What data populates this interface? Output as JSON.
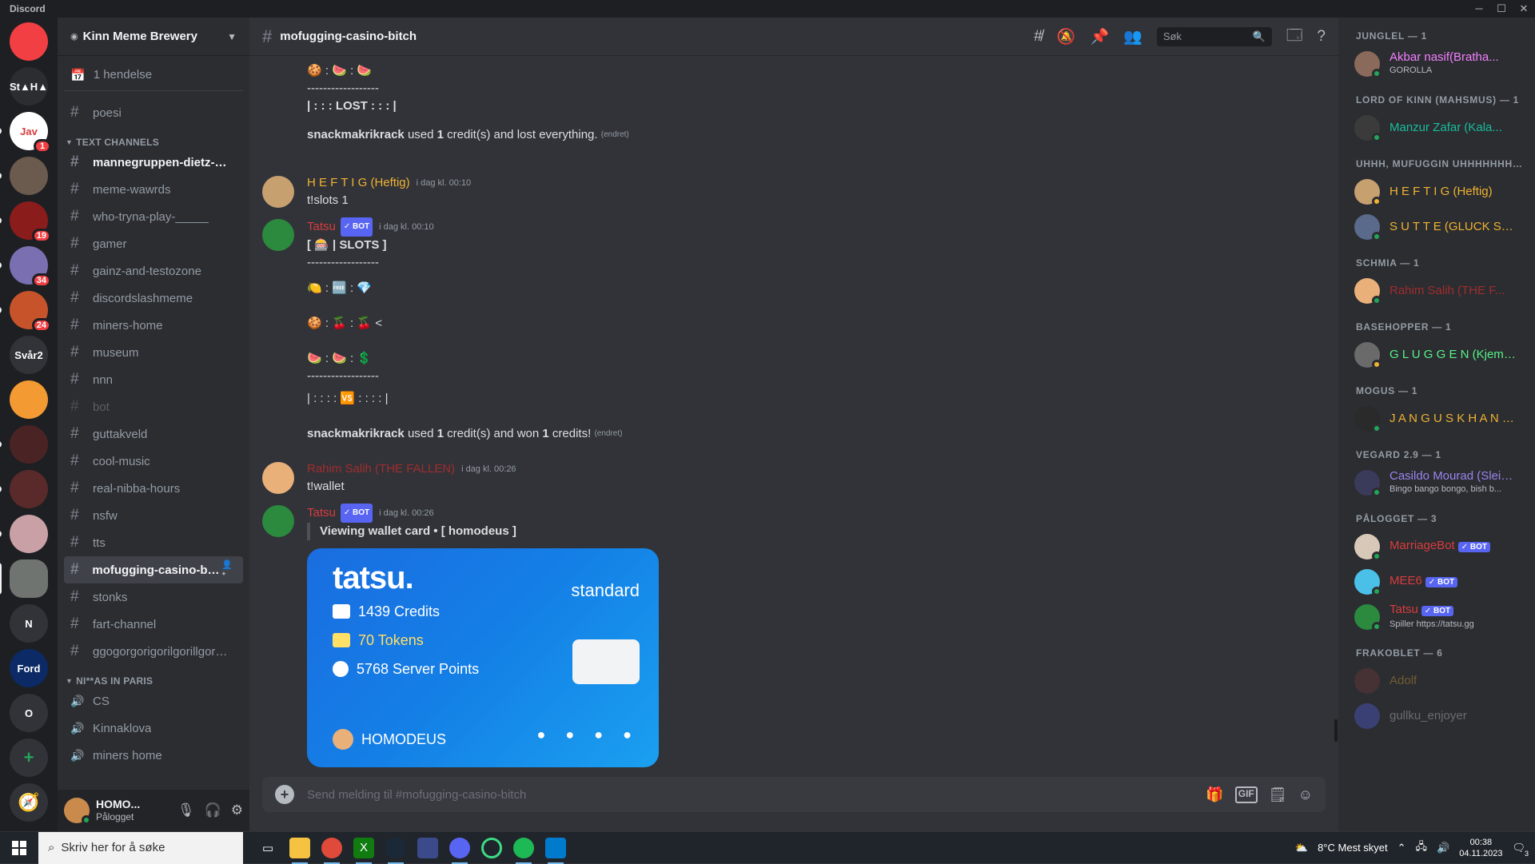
{
  "window": {
    "title": "Discord"
  },
  "servers": [
    {
      "name": "discord-home",
      "label": "",
      "color": "#f23f43",
      "badge": ""
    },
    {
      "name": "server-staha",
      "label": "St▲H▲",
      "color": "#2b2d31",
      "badge": ""
    },
    {
      "name": "server-java",
      "label": "Jav",
      "color": "#ffffff",
      "badge": "1"
    },
    {
      "name": "server-rat",
      "label": "",
      "color": "#6b5a4e",
      "badge": ""
    },
    {
      "name": "server-tekken",
      "label": "",
      "color": "#8b1c1c",
      "badge": "19"
    },
    {
      "name": "server-face",
      "label": "",
      "color": "#7a6fb0",
      "badge": "34"
    },
    {
      "name": "server-fire",
      "label": "",
      "color": "#c6532a",
      "badge": "24"
    },
    {
      "name": "server-svar2",
      "label": "Svår2",
      "color": "#313338",
      "badge": ""
    },
    {
      "name": "server-pizza",
      "label": "",
      "color": "#f39a33",
      "badge": ""
    },
    {
      "name": "server-dark-face",
      "label": "",
      "color": "#4a2424",
      "badge": ""
    },
    {
      "name": "server-red-face",
      "label": "",
      "color": "#5a2a2a",
      "badge": ""
    },
    {
      "name": "server-pink",
      "label": "",
      "color": "#c8a0a5",
      "badge": ""
    },
    {
      "name": "server-kinn",
      "label": "",
      "color": "#6f7470",
      "badge": ""
    },
    {
      "name": "server-n",
      "label": "N",
      "color": "#313338",
      "badge": ""
    },
    {
      "name": "server-ford",
      "label": "Ford",
      "color": "#0b2a66",
      "badge": ""
    },
    {
      "name": "server-o",
      "label": "O",
      "color": "#313338",
      "badge": ""
    }
  ],
  "guild": {
    "name": "Kinn Meme Brewery"
  },
  "channels": {
    "event": "1 hendelse",
    "top": [
      {
        "name": "poesi",
        "state": "normal"
      }
    ],
    "categories": [
      {
        "label": "TEXT CHANNELS",
        "items": [
          {
            "name": "mannegruppen-dietz-nuts",
            "state": "unread"
          },
          {
            "name": "meme-wawrds",
            "state": "normal"
          },
          {
            "name": "who-tryna-play-_____",
            "state": "normal"
          },
          {
            "name": "gamer",
            "state": "normal"
          },
          {
            "name": "gainz-and-testozone",
            "state": "normal"
          },
          {
            "name": "discordslashmeme",
            "state": "normal"
          },
          {
            "name": "miners-home",
            "state": "normal"
          },
          {
            "name": "museum",
            "state": "normal"
          },
          {
            "name": "nnn",
            "state": "normal"
          },
          {
            "name": "bot",
            "state": "muted"
          },
          {
            "name": "guttakveld",
            "state": "normal"
          },
          {
            "name": "cool-music",
            "state": "normal"
          },
          {
            "name": "real-nibba-hours",
            "state": "normal"
          },
          {
            "name": "nsfw",
            "state": "normal"
          },
          {
            "name": "tts",
            "state": "normal"
          },
          {
            "name": "mofugging-casino-bit...",
            "state": "selected"
          },
          {
            "name": "stonks",
            "state": "normal"
          },
          {
            "name": "fart-channel",
            "state": "normal"
          },
          {
            "name": "ggogorgorigorilgorillgorilla",
            "state": "normal"
          }
        ]
      },
      {
        "label": "NI**AS IN PARIS",
        "items": [
          {
            "name": "CS",
            "state": "voice"
          },
          {
            "name": "Kinnaklova",
            "state": "voice"
          },
          {
            "name": "miners home",
            "state": "voice"
          }
        ]
      }
    ]
  },
  "user": {
    "name": "HOMO...",
    "status": "Pålogget"
  },
  "header": {
    "channel": "mofugging-casino-bitch",
    "search_placeholder": "Søk"
  },
  "messages": {
    "m1": {
      "line1": "🍪 : 🍉 : 🍉",
      "line2": "------------------",
      "line3": "| : : :  LOST  : : : |",
      "footer_user": "snackmakrikrack",
      "footer_used": "used",
      "footer_credits": "1",
      "footer_text": "credit(s) and lost everything.",
      "edited": "(endret)"
    },
    "m2": {
      "author": "H E F T I G (Heftig)",
      "author_color": "#f0b232",
      "ts": "i dag kl. 00:10",
      "text": "t!slots 1"
    },
    "m3": {
      "author": "Tatsu",
      "author_color": "#d83c3e",
      "bot": "✓ BOT",
      "ts": "i dag kl. 00:10",
      "title": "[ 🎰 | SLOTS ]",
      "sep": "------------------",
      "r1": "🍋 : 🆓 : 💎",
      "r2": "🍪 : 🍒 : 🍒  <",
      "r3": "🍉 : 🍉 : 💲",
      "sep2": "------------------",
      "result": "| : : : :  🆚  : : : : |",
      "footer_user": "snackmakrikrack",
      "footer_used": "used",
      "footer_credits": "1",
      "footer_mid": "credit(s) and won",
      "footer_won": "1",
      "footer_end": "credits!",
      "edited": "(endret)"
    },
    "m4": {
      "author": "Rahim Salih (THE FALLEN)",
      "author_color": "#a12d2f",
      "ts": "i dag kl. 00:26",
      "text": "t!wallet"
    },
    "m5": {
      "author": "Tatsu",
      "author_color": "#d83c3e",
      "bot": "✓ BOT",
      "ts": "i dag kl. 00:26",
      "title": "Viewing wallet card • [  homodeus ]"
    }
  },
  "wallet": {
    "brand": "tatsu.",
    "tier": "standard",
    "credits": "1439 Credits",
    "tokens": "70 Tokens",
    "points": "5768 Server Points",
    "owner": "HOMODEUS",
    "dots": "● ● ● ●"
  },
  "composer": {
    "placeholder": "Send melding til #mofugging-casino-bitch"
  },
  "members": [
    {
      "group": "JUNGLEL — 1",
      "users": [
        {
          "name": "Akbar nasif(Bratha...",
          "color": "#f47fff",
          "sub": "GOROLLA",
          "status": "online",
          "bot": ""
        }
      ]
    },
    {
      "group": "LORD OF KINN (MAHSMUS) — 1",
      "users": [
        {
          "name": "Manzur Zafar (Kala...",
          "color": "#1abc9c",
          "sub": "",
          "status": "online",
          "bot": ""
        }
      ]
    },
    {
      "group": "UHHH, MUFUGGIN UHHHHHHHHH ...",
      "users": [
        {
          "name": "H E F T I G (Heftig)",
          "color": "#f0b232",
          "sub": "",
          "status": "idle",
          "bot": ""
        },
        {
          "name": "S U T T E (GLUCK SLU...",
          "color": "#f0b232",
          "sub": "",
          "status": "online",
          "bot": ""
        }
      ]
    },
    {
      "group": "SCHMIA — 1",
      "users": [
        {
          "name": "Rahim Salih (THE F...",
          "color": "#a12d2f",
          "sub": "",
          "status": "online",
          "bot": ""
        }
      ]
    },
    {
      "group": "BASEHOPPER — 1",
      "users": [
        {
          "name": "G L U G G E N (Kjemp...",
          "color": "#57f287",
          "sub": "",
          "status": "idle",
          "bot": ""
        }
      ]
    },
    {
      "group": "MOGUS — 1",
      "users": [
        {
          "name": "J A N G U S K H A N B(...",
          "color": "#f0b232",
          "sub": "",
          "status": "online",
          "bot": ""
        }
      ]
    },
    {
      "group": "VEGARD 2.9 — 1",
      "users": [
        {
          "name": "Casildo Mourad (Sleip...",
          "color": "#9b84ee",
          "sub": "Bingo bango bongo, bish b...",
          "status": "online",
          "bot": ""
        }
      ]
    },
    {
      "group": "PÅLOGGET — 3",
      "users": [
        {
          "name": "MarriageBot",
          "color": "#d83c3e",
          "sub": "",
          "status": "online",
          "bot": "✓ BOT"
        },
        {
          "name": "MEE6",
          "color": "#d83c3e",
          "sub": "",
          "status": "online",
          "bot": "✓ BOT"
        },
        {
          "name": "Tatsu",
          "color": "#d83c3e",
          "sub": "Spiller https://tatsu.gg",
          "status": "online",
          "bot": "✓ BOT"
        }
      ]
    },
    {
      "group": "FRAKOBLET — 6",
      "users": [
        {
          "name": "Adolf",
          "color": "#f0b232",
          "sub": "",
          "status": "offline",
          "bot": ""
        },
        {
          "name": "gullku_enjoyer",
          "color": "#dbdee1",
          "sub": "",
          "status": "offline",
          "bot": ""
        }
      ]
    }
  ],
  "taskbar": {
    "search": "Skriv her for å søke",
    "weather": "8°C  Mest skyet",
    "time": "00:38",
    "date": "04.11.2023",
    "notif": "3"
  }
}
